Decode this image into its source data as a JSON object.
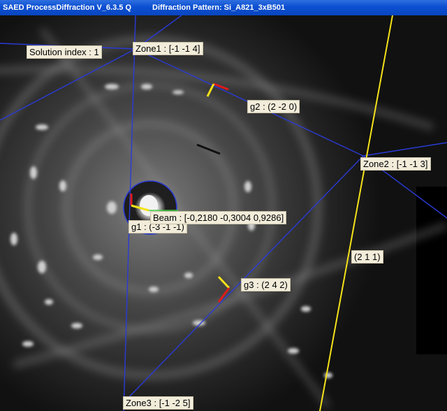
{
  "window": {
    "app_title": "SAED ProcessDiffraction V_6.3.5 Q",
    "pattern_title": "Diffraction Pattern: Si_A821_3xB501"
  },
  "overlay": {
    "solution_index": "Solution index : 1",
    "zone1": "Zone1  : [-1  -1 4]",
    "zone2": "Zone2  : [-1  -1 3]",
    "zone3": "Zone3  : [-1  -2 5]",
    "g1": "g1  : (-3  -1 -1)",
    "g2": "g2  : (2  -2 0)",
    "g3": "g3  : (2  4 2)",
    "beam": "Beam  : [-0,2180  -0,3004  0,9286]",
    "plane": "(2 1 1)"
  },
  "colors": {
    "zone_line": "#2a3bd6",
    "trace_line": "#f4e21a",
    "marker_red": "#e01a1a",
    "marker_yellow": "#f4e21a",
    "marker_green": "#3fd23f",
    "label_bg": "#f2ecda",
    "titlebar": "#0b4fd1"
  }
}
